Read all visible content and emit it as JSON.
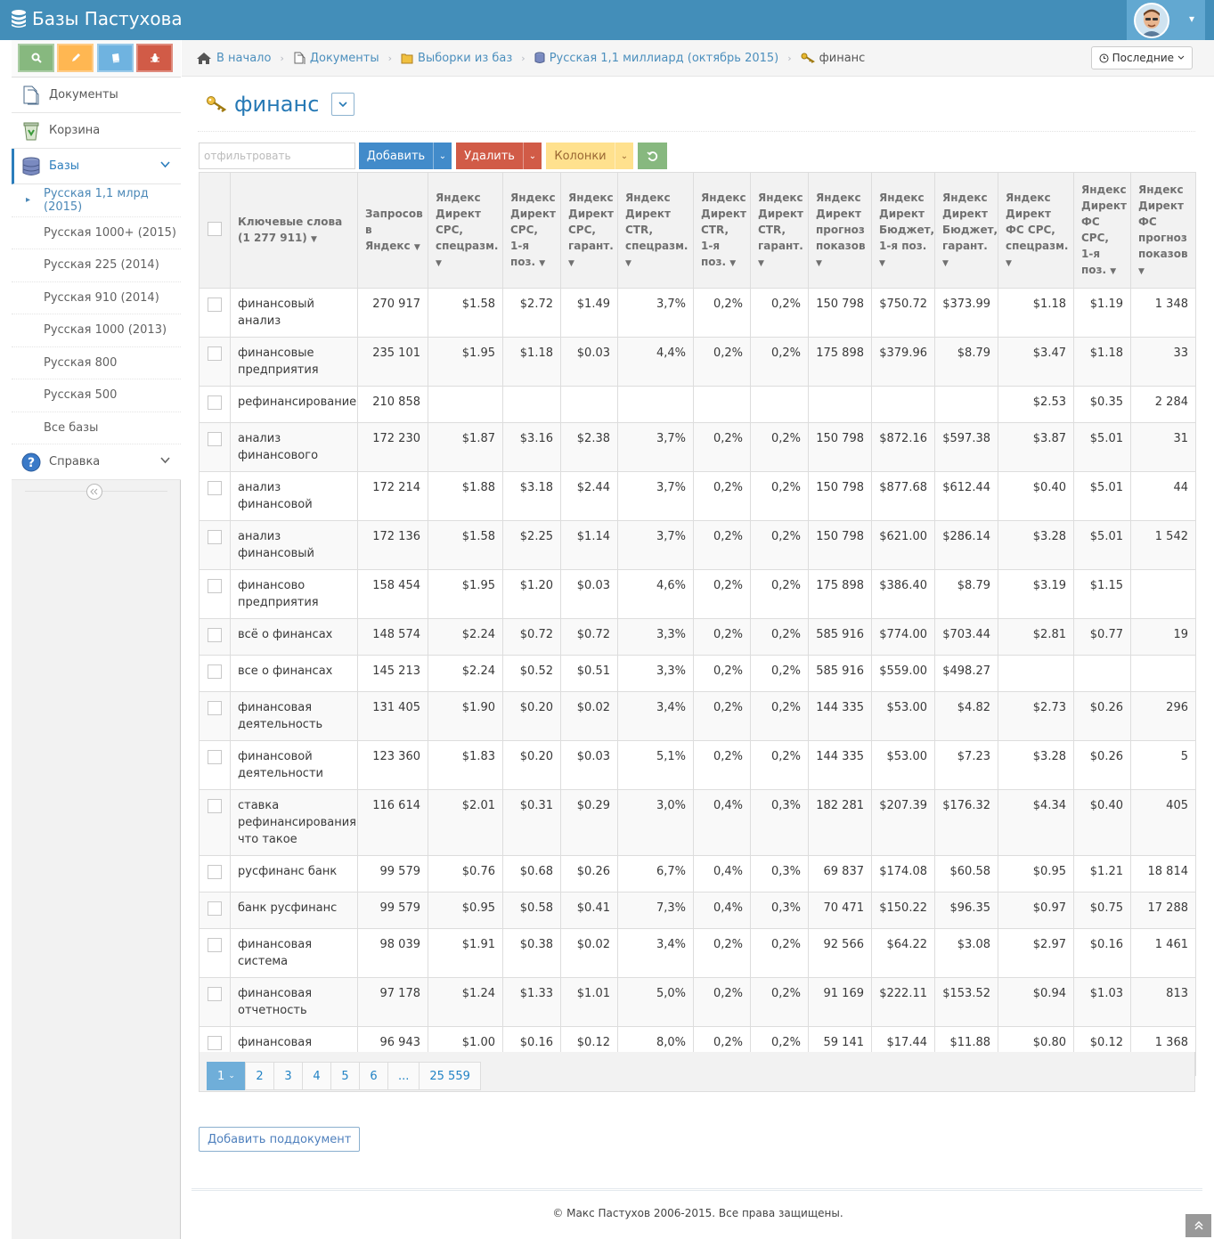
{
  "app": {
    "title": "Базы Пастухова"
  },
  "user": {
    "menu_caret": "▾"
  },
  "sidebar": {
    "items": [
      {
        "label": "Документы"
      },
      {
        "label": "Корзина"
      },
      {
        "label": "Базы"
      }
    ],
    "bases": [
      {
        "label": "Русская 1,1 млрд (2015)"
      },
      {
        "label": "Русская 1000+ (2015)"
      },
      {
        "label": "Русская 225 (2014)"
      },
      {
        "label": "Русская 910 (2014)"
      },
      {
        "label": "Русская 1000 (2013)"
      },
      {
        "label": "Русская 800"
      },
      {
        "label": "Русская 500"
      },
      {
        "label": "Все базы"
      }
    ],
    "help": {
      "label": "Справка"
    }
  },
  "breadcrumbs": [
    {
      "label": "В начало"
    },
    {
      "label": "Документы"
    },
    {
      "label": "Выборки из баз"
    },
    {
      "label": "Русская 1,1 миллиард (октябрь 2015)"
    },
    {
      "label": "финанс"
    }
  ],
  "recent": {
    "label": "Последние"
  },
  "page": {
    "title": "финанс"
  },
  "toolbar": {
    "filter_placeholder": "отфильтровать",
    "add_label": "Добавить",
    "delete_label": "Удалить",
    "columns_label": "Колонки"
  },
  "colors": {
    "navbar": "#438eb9",
    "add": "#428bca",
    "delete": "#d15b47",
    "columns": "#ffe18e",
    "refresh": "#87b87f"
  },
  "table": {
    "headers": [
      "Ключевые слова (1 277 911)",
      "Запросов в Яндекс",
      "Яндекс Директ CPC, спецразм.",
      "Яндекс Директ CPC, 1-я поз.",
      "Яндекс Директ CPC, гарант.",
      "Яндекс Директ CTR, спецразм.",
      "Яндекс Директ CTR, 1-я поз.",
      "Яндекс Директ CTR, гарант.",
      "Яндекс Директ прогноз показов",
      "Яндекс Директ Бюджет, 1-я поз.",
      "Яндекс Директ Бюджет, гарант.",
      "Яндекс Директ ФС CPC, спецразм.",
      "Яндекс Директ ФС CPC, 1-я поз.",
      "Яндекс Директ ФС прогноз показов"
    ],
    "rows": [
      [
        "финансовый анализ",
        "270 917",
        "$1.58",
        "$2.72",
        "$1.49",
        "3,7%",
        "0,2%",
        "0,2%",
        "150 798",
        "$750.72",
        "$373.99",
        "$1.18",
        "$1.19",
        "1 348"
      ],
      [
        "финансовые предприятия",
        "235 101",
        "$1.95",
        "$1.18",
        "$0.03",
        "4,4%",
        "0,2%",
        "0,2%",
        "175 898",
        "$379.96",
        "$8.79",
        "$3.47",
        "$1.18",
        "33"
      ],
      [
        "рефинансирование",
        "210 858",
        "",
        "",
        "",
        "",
        "",
        "",
        "",
        "",
        "",
        "$2.53",
        "$0.35",
        "2 284"
      ],
      [
        "анализ финансового",
        "172 230",
        "$1.87",
        "$3.16",
        "$2.38",
        "3,7%",
        "0,2%",
        "0,2%",
        "150 798",
        "$872.16",
        "$597.38",
        "$3.87",
        "$5.01",
        "31"
      ],
      [
        "анализ финансовой",
        "172 214",
        "$1.88",
        "$3.18",
        "$2.44",
        "3,7%",
        "0,2%",
        "0,2%",
        "150 798",
        "$877.68",
        "$612.44",
        "$0.40",
        "$5.01",
        "44"
      ],
      [
        "анализ финансовый",
        "172 136",
        "$1.58",
        "$2.25",
        "$1.14",
        "3,7%",
        "0,2%",
        "0,2%",
        "150 798",
        "$621.00",
        "$286.14",
        "$3.28",
        "$5.01",
        "1 542"
      ],
      [
        "финансово предприятия",
        "158 454",
        "$1.95",
        "$1.20",
        "$0.03",
        "4,6%",
        "0,2%",
        "0,2%",
        "175 898",
        "$386.40",
        "$8.79",
        "$3.19",
        "$1.15",
        ""
      ],
      [
        "всё о финансах",
        "148 574",
        "$2.24",
        "$0.72",
        "$0.72",
        "3,3%",
        "0,2%",
        "0,2%",
        "585 916",
        "$774.00",
        "$703.44",
        "$2.81",
        "$0.77",
        "19"
      ],
      [
        "все о финансах",
        "145 213",
        "$2.24",
        "$0.52",
        "$0.51",
        "3,3%",
        "0,2%",
        "0,2%",
        "585 916",
        "$559.00",
        "$498.27",
        "",
        "",
        ""
      ],
      [
        "финансовая деятельность",
        "131 405",
        "$1.90",
        "$0.20",
        "$0.02",
        "3,4%",
        "0,2%",
        "0,2%",
        "144 335",
        "$53.00",
        "$4.82",
        "$2.73",
        "$0.26",
        "296"
      ],
      [
        "финансовой деятельности",
        "123 360",
        "$1.83",
        "$0.20",
        "$0.03",
        "5,1%",
        "0,2%",
        "0,2%",
        "144 335",
        "$53.00",
        "$7.23",
        "$3.28",
        "$0.26",
        "5"
      ],
      [
        "ставка рефинансирования что такое",
        "116 614",
        "$2.01",
        "$0.31",
        "$0.29",
        "3,0%",
        "0,4%",
        "0,3%",
        "182 281",
        "$207.39",
        "$176.32",
        "$4.34",
        "$0.40",
        "405"
      ],
      [
        "русфинанс банк",
        "99 579",
        "$0.76",
        "$0.68",
        "$0.26",
        "6,7%",
        "0,4%",
        "0,3%",
        "69 837",
        "$174.08",
        "$60.58",
        "$0.95",
        "$1.21",
        "18 814"
      ],
      [
        "банк русфинанс",
        "99 579",
        "$0.95",
        "$0.58",
        "$0.41",
        "7,3%",
        "0,4%",
        "0,3%",
        "70 471",
        "$150.22",
        "$96.35",
        "$0.97",
        "$0.75",
        "17 288"
      ],
      [
        "финансовая система",
        "98 039",
        "$1.91",
        "$0.38",
        "$0.02",
        "3,4%",
        "0,2%",
        "0,2%",
        "92 566",
        "$64.22",
        "$3.08",
        "$2.97",
        "$0.16",
        "1 461"
      ],
      [
        "финансовая отчетность",
        "97 178",
        "$1.24",
        "$1.33",
        "$1.01",
        "5,0%",
        "0,2%",
        "0,2%",
        "91 169",
        "$222.11",
        "$153.52",
        "$0.94",
        "$1.03",
        "813"
      ],
      [
        "финансовая устойчивость",
        "96 943",
        "$1.00",
        "$0.16",
        "$0.12",
        "8,0%",
        "0,2%",
        "0,2%",
        "59 141",
        "$17.44",
        "$11.88",
        "$0.80",
        "$0.12",
        "1 368"
      ]
    ]
  },
  "pagination": {
    "pages": [
      "1",
      "2",
      "3",
      "4",
      "5",
      "6",
      "...",
      "25 559"
    ],
    "current": "1"
  },
  "add_subdocument": {
    "label": "Добавить поддокумент"
  },
  "footer": {
    "text": "© Макс Пастухов 2006-2015. Все права защищены."
  }
}
